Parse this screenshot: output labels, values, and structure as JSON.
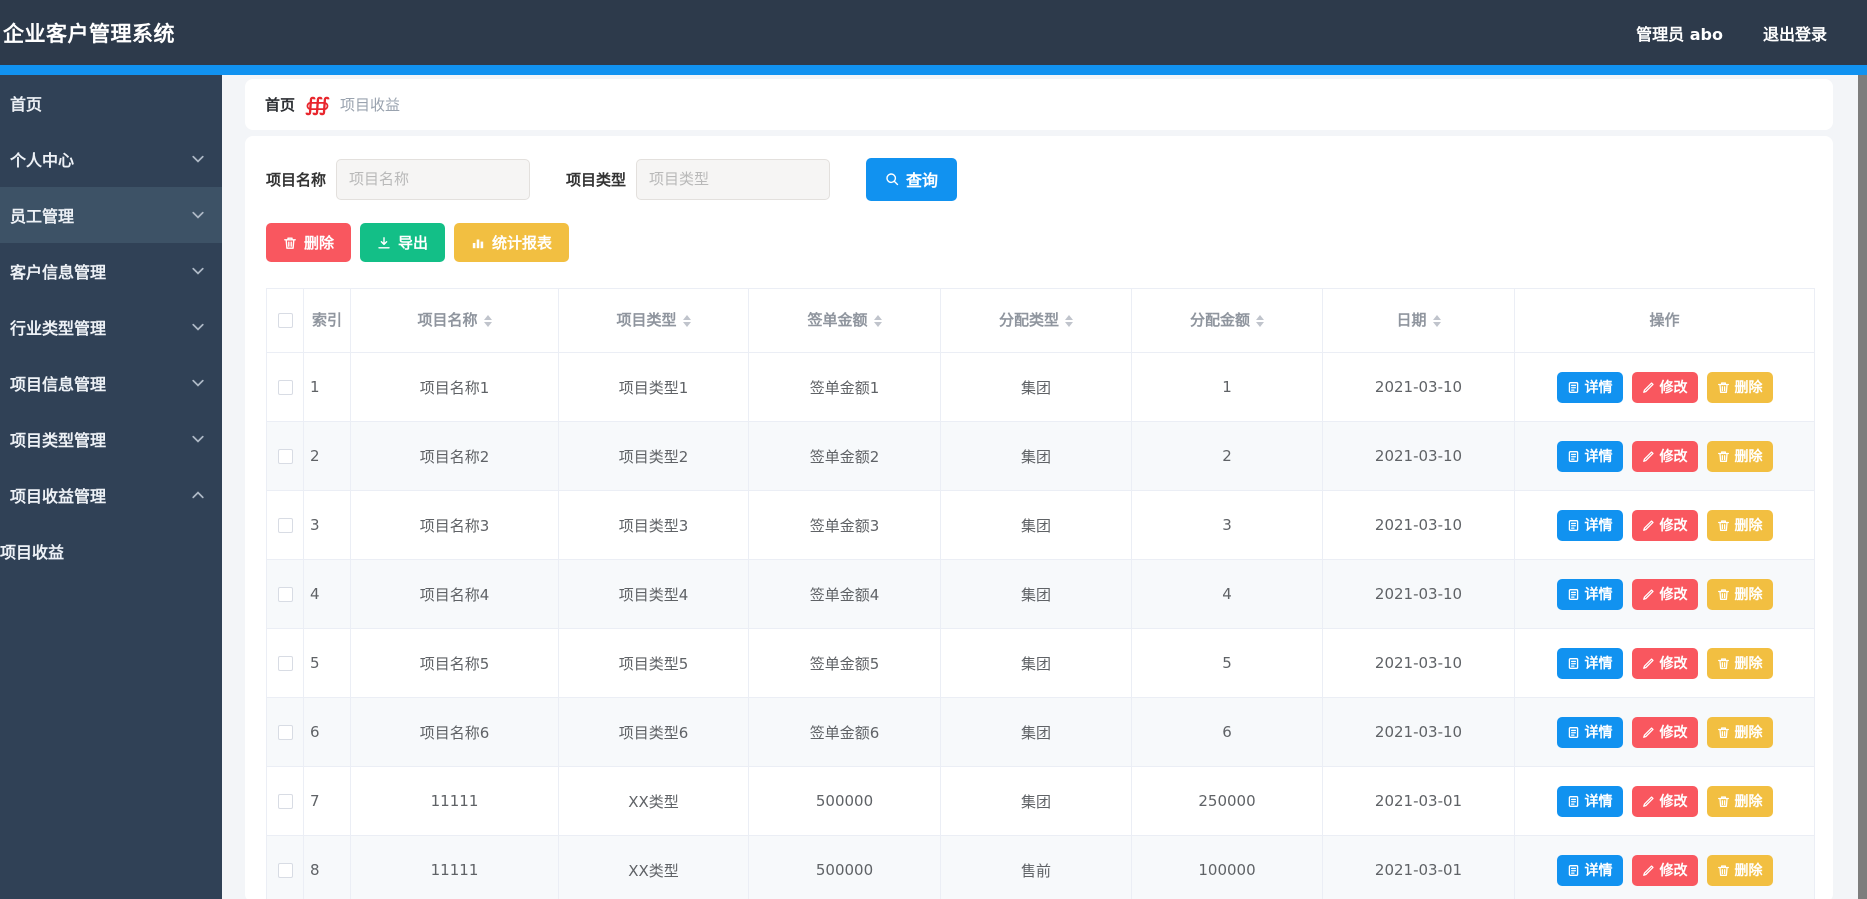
{
  "app": {
    "title": "企业客户管理系统"
  },
  "header": {
    "user": "管理员 abo",
    "logout": "退出登录"
  },
  "sidebar": {
    "items": [
      {
        "label": "首页",
        "arrow": "none",
        "active": false,
        "submenu": false
      },
      {
        "label": "个人中心",
        "arrow": "down",
        "active": false,
        "submenu": false
      },
      {
        "label": "员工管理",
        "arrow": "down",
        "active": true,
        "submenu": false
      },
      {
        "label": "客户信息管理",
        "arrow": "down",
        "active": false,
        "submenu": false
      },
      {
        "label": "行业类型管理",
        "arrow": "down",
        "active": false,
        "submenu": false
      },
      {
        "label": "项目信息管理",
        "arrow": "down",
        "active": false,
        "submenu": false
      },
      {
        "label": "项目类型管理",
        "arrow": "down",
        "active": false,
        "submenu": false
      },
      {
        "label": "项目收益管理",
        "arrow": "up",
        "active": false,
        "submenu": false
      },
      {
        "label": "项目收益",
        "arrow": "none",
        "active": false,
        "submenu": true
      }
    ]
  },
  "breadcrumb": {
    "home": "首页",
    "separator_icon": "slashes-icon",
    "current": "项目收益"
  },
  "filters": {
    "name_label": "项目名称",
    "name_placeholder": "项目名称",
    "name_value": "",
    "type_label": "项目类型",
    "type_placeholder": "项目类型",
    "type_value": "",
    "search": {
      "label": "查询",
      "icon": "search-icon"
    }
  },
  "toolbar": [
    {
      "label": "删除",
      "icon": "trash-icon",
      "color": "red"
    },
    {
      "label": "导出",
      "icon": "download-icon",
      "color": "green"
    },
    {
      "label": "统计报表",
      "icon": "chart-icon",
      "color": "yellow"
    }
  ],
  "table": {
    "columns": [
      {
        "key": "select",
        "label": "",
        "sortable": false
      },
      {
        "key": "index",
        "label": "索引",
        "sortable": false
      },
      {
        "key": "name",
        "label": "项目名称",
        "sortable": true
      },
      {
        "key": "type",
        "label": "项目类型",
        "sortable": true
      },
      {
        "key": "amount",
        "label": "签单金额",
        "sortable": true
      },
      {
        "key": "alloc_type",
        "label": "分配类型",
        "sortable": true
      },
      {
        "key": "alloc_amount",
        "label": "分配金额",
        "sortable": true
      },
      {
        "key": "date",
        "label": "日期",
        "sortable": true
      },
      {
        "key": "ops",
        "label": "操作",
        "sortable": false
      }
    ],
    "rows": [
      {
        "index": "1",
        "name": "项目名称1",
        "type": "项目类型1",
        "amount": "签单金额1",
        "alloc_type": "集团",
        "alloc_amount": "1",
        "date": "2021-03-10"
      },
      {
        "index": "2",
        "name": "项目名称2",
        "type": "项目类型2",
        "amount": "签单金额2",
        "alloc_type": "集团",
        "alloc_amount": "2",
        "date": "2021-03-10"
      },
      {
        "index": "3",
        "name": "项目名称3",
        "type": "项目类型3",
        "amount": "签单金额3",
        "alloc_type": "集团",
        "alloc_amount": "3",
        "date": "2021-03-10"
      },
      {
        "index": "4",
        "name": "项目名称4",
        "type": "项目类型4",
        "amount": "签单金额4",
        "alloc_type": "集团",
        "alloc_amount": "4",
        "date": "2021-03-10"
      },
      {
        "index": "5",
        "name": "项目名称5",
        "type": "项目类型5",
        "amount": "签单金额5",
        "alloc_type": "集团",
        "alloc_amount": "5",
        "date": "2021-03-10"
      },
      {
        "index": "6",
        "name": "项目名称6",
        "type": "项目类型6",
        "amount": "签单金额6",
        "alloc_type": "集团",
        "alloc_amount": "6",
        "date": "2021-03-10"
      },
      {
        "index": "7",
        "name": "11111",
        "type": "XX类型",
        "amount": "500000",
        "alloc_type": "集团",
        "alloc_amount": "250000",
        "date": "2021-03-01"
      },
      {
        "index": "8",
        "name": "11111",
        "type": "XX类型",
        "amount": "500000",
        "alloc_type": "售前",
        "alloc_amount": "100000",
        "date": "2021-03-01"
      }
    ],
    "row_actions": [
      {
        "label": "详情",
        "icon": "doc-icon",
        "color": "blue"
      },
      {
        "label": "修改",
        "icon": "edit-icon",
        "color": "red"
      },
      {
        "label": "删除",
        "icon": "trash-icon",
        "color": "yellow"
      }
    ]
  },
  "colors": {
    "navbar": "#2d3a4b",
    "strip": "#0f90f1",
    "sidebar": "#304156",
    "sidebar_active": "#3d5266",
    "primary": "#1192f0",
    "red": "#f9575f",
    "green": "#13bf87",
    "yellow": "#f2bf41",
    "page_bg": "#f3f5f8",
    "breadcrumb_sep": "#e8262d",
    "table_border": "#ebeef5",
    "stripe": "#f7f9fb"
  }
}
